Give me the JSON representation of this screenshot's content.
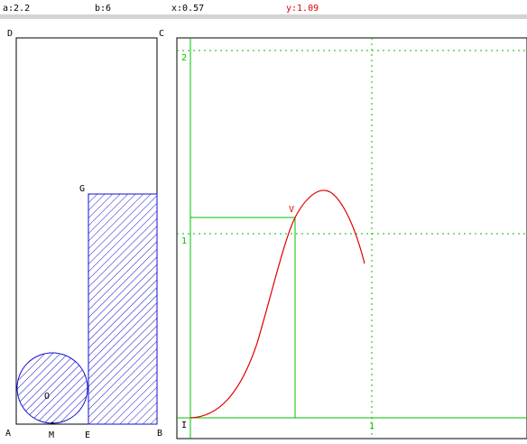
{
  "toolbar": {
    "a_label": "a:2.2",
    "b_label": "b:6",
    "x_label": "x:0.57",
    "y_label": "y:1.09"
  },
  "colors": {
    "curve": "#e00000",
    "grid": "#00c000",
    "hatch": "#1010d0",
    "y_readout": "#e00000"
  },
  "figure": {
    "points": {
      "A": "A",
      "B": "B",
      "C": "C",
      "D": "D",
      "G": "G",
      "E": "E",
      "M": "M",
      "O": "O"
    }
  },
  "graph": {
    "origin_label": "I",
    "x_tick_1": "1",
    "y_tick_1": "1",
    "y_tick_2": "2",
    "point_label": "V"
  }
}
